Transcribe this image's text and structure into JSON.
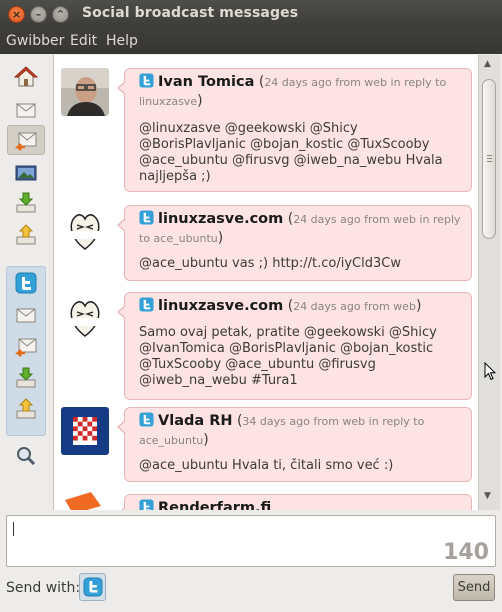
{
  "window": {
    "title": "Social broadcast messages",
    "close_glyph": "×",
    "min_glyph": "–",
    "max_glyph": "⌃"
  },
  "menu": [
    "Gwibber",
    "Edit",
    "Help"
  ],
  "sidebar": {
    "groups": [
      {
        "name": "all-accounts",
        "items": [
          "home-icon",
          "messages-icon",
          "replies-icon",
          "images-icon",
          "inbox-download-icon",
          "outbox-upload-icon"
        ]
      },
      {
        "name": "twitter-account",
        "items": [
          "twitter-icon",
          "messages-icon",
          "replies-icon",
          "inbox-download-icon",
          "outbox-upload-icon"
        ]
      }
    ],
    "search": "search-icon"
  },
  "posts": [
    {
      "author": "Ivan Tomica",
      "meta": "24 days ago from web in reply to linuxzasve",
      "body": "@linuxzasve @geekowski @Shicy @BorisPlavljanic @bojan_kostic @TuxScooby @ace_ubuntu @firusvg @iweb_na_webu Hvala najljepša ;)"
    },
    {
      "author": "linuxzasve.com",
      "meta": "24 days ago from web in reply to ace_ubuntu",
      "body": "@ace_ubuntu vas ;) http://t.co/iyCld3Cw"
    },
    {
      "author": "linuxzasve.com",
      "meta": "24 days ago from web",
      "body": "Samo ovaj petak, pratite @geekowski @Shicy @IvanTomica @BorisPlavljanic @bojan_kostic @TuxScooby @ace_ubuntu @firusvg @iweb_na_webu #Tura1"
    },
    {
      "author": "Vlada RH",
      "meta": "34 days ago from web in reply to ace_ubuntu",
      "body": "@ace_ubuntu Hvala ti, čitali smo već :)"
    },
    {
      "author": "Renderfarm.fi",
      "meta": "",
      "body": ""
    }
  ],
  "compose": {
    "value": "",
    "counter": "140",
    "send_with_label": "Send with:",
    "send_label": "Send"
  },
  "colors": {
    "bubble": "#fde3e3",
    "bubble_border": "#e7b7b7",
    "twitter_blue": "#33a0d8",
    "titlebar": "#3c3b37"
  }
}
